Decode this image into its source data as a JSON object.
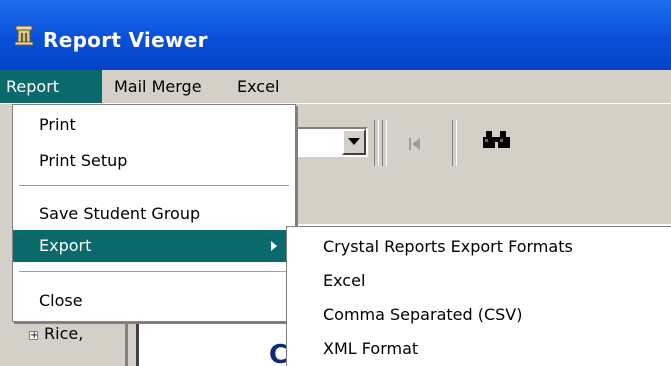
{
  "window": {
    "title": "Report Viewer"
  },
  "menubar": {
    "items": [
      "Report",
      "Mail Merge",
      "Excel"
    ],
    "active": "Report"
  },
  "report_menu": {
    "items": [
      {
        "label": "Print"
      },
      {
        "label": "Print Setup"
      },
      {
        "label": "Save Student Group"
      },
      {
        "label": "Export",
        "has_submenu": true,
        "highlighted": true
      },
      {
        "label": "Close"
      }
    ]
  },
  "export_submenu": {
    "items": [
      "Crystal Reports Export Formats",
      "Excel",
      "Comma Separated (CSV)",
      "XML Format"
    ]
  },
  "tree": {
    "node_label": "Rice,"
  },
  "content": {
    "partial_text": "C"
  },
  "colors": {
    "titlebar": "#0a4fd9",
    "highlight": "#0a6a6b",
    "chrome": "#d4d0c8"
  }
}
